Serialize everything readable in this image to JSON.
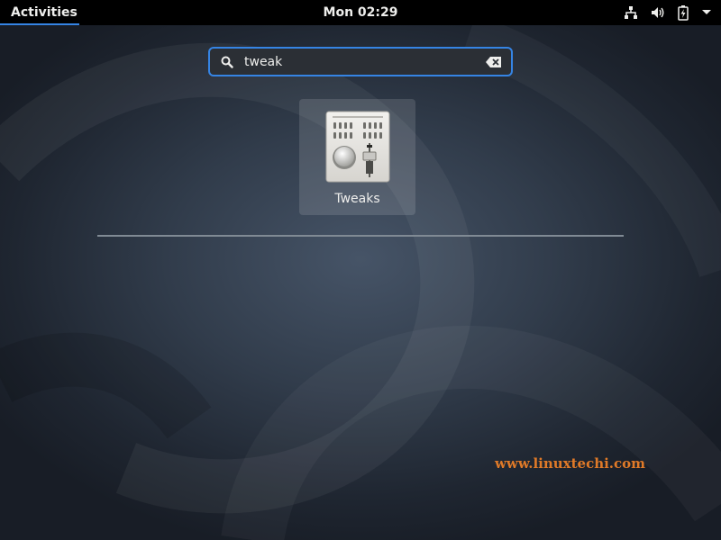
{
  "topbar": {
    "activities_label": "Activities",
    "clock": "Mon 02:29",
    "status_icons": [
      "network-icon",
      "volume-icon",
      "battery-icon",
      "system-menu-arrow-icon"
    ]
  },
  "search": {
    "value": "tweak",
    "icon": "search-icon",
    "clear_icon": "clear-icon"
  },
  "results": [
    {
      "label": "Tweaks",
      "icon": "tweaks-app-icon"
    }
  ],
  "watermark": "www.linuxtechi.com",
  "colors": {
    "accent": "#3584e4",
    "topbar": "#000000",
    "watermark": "#e07a28"
  }
}
